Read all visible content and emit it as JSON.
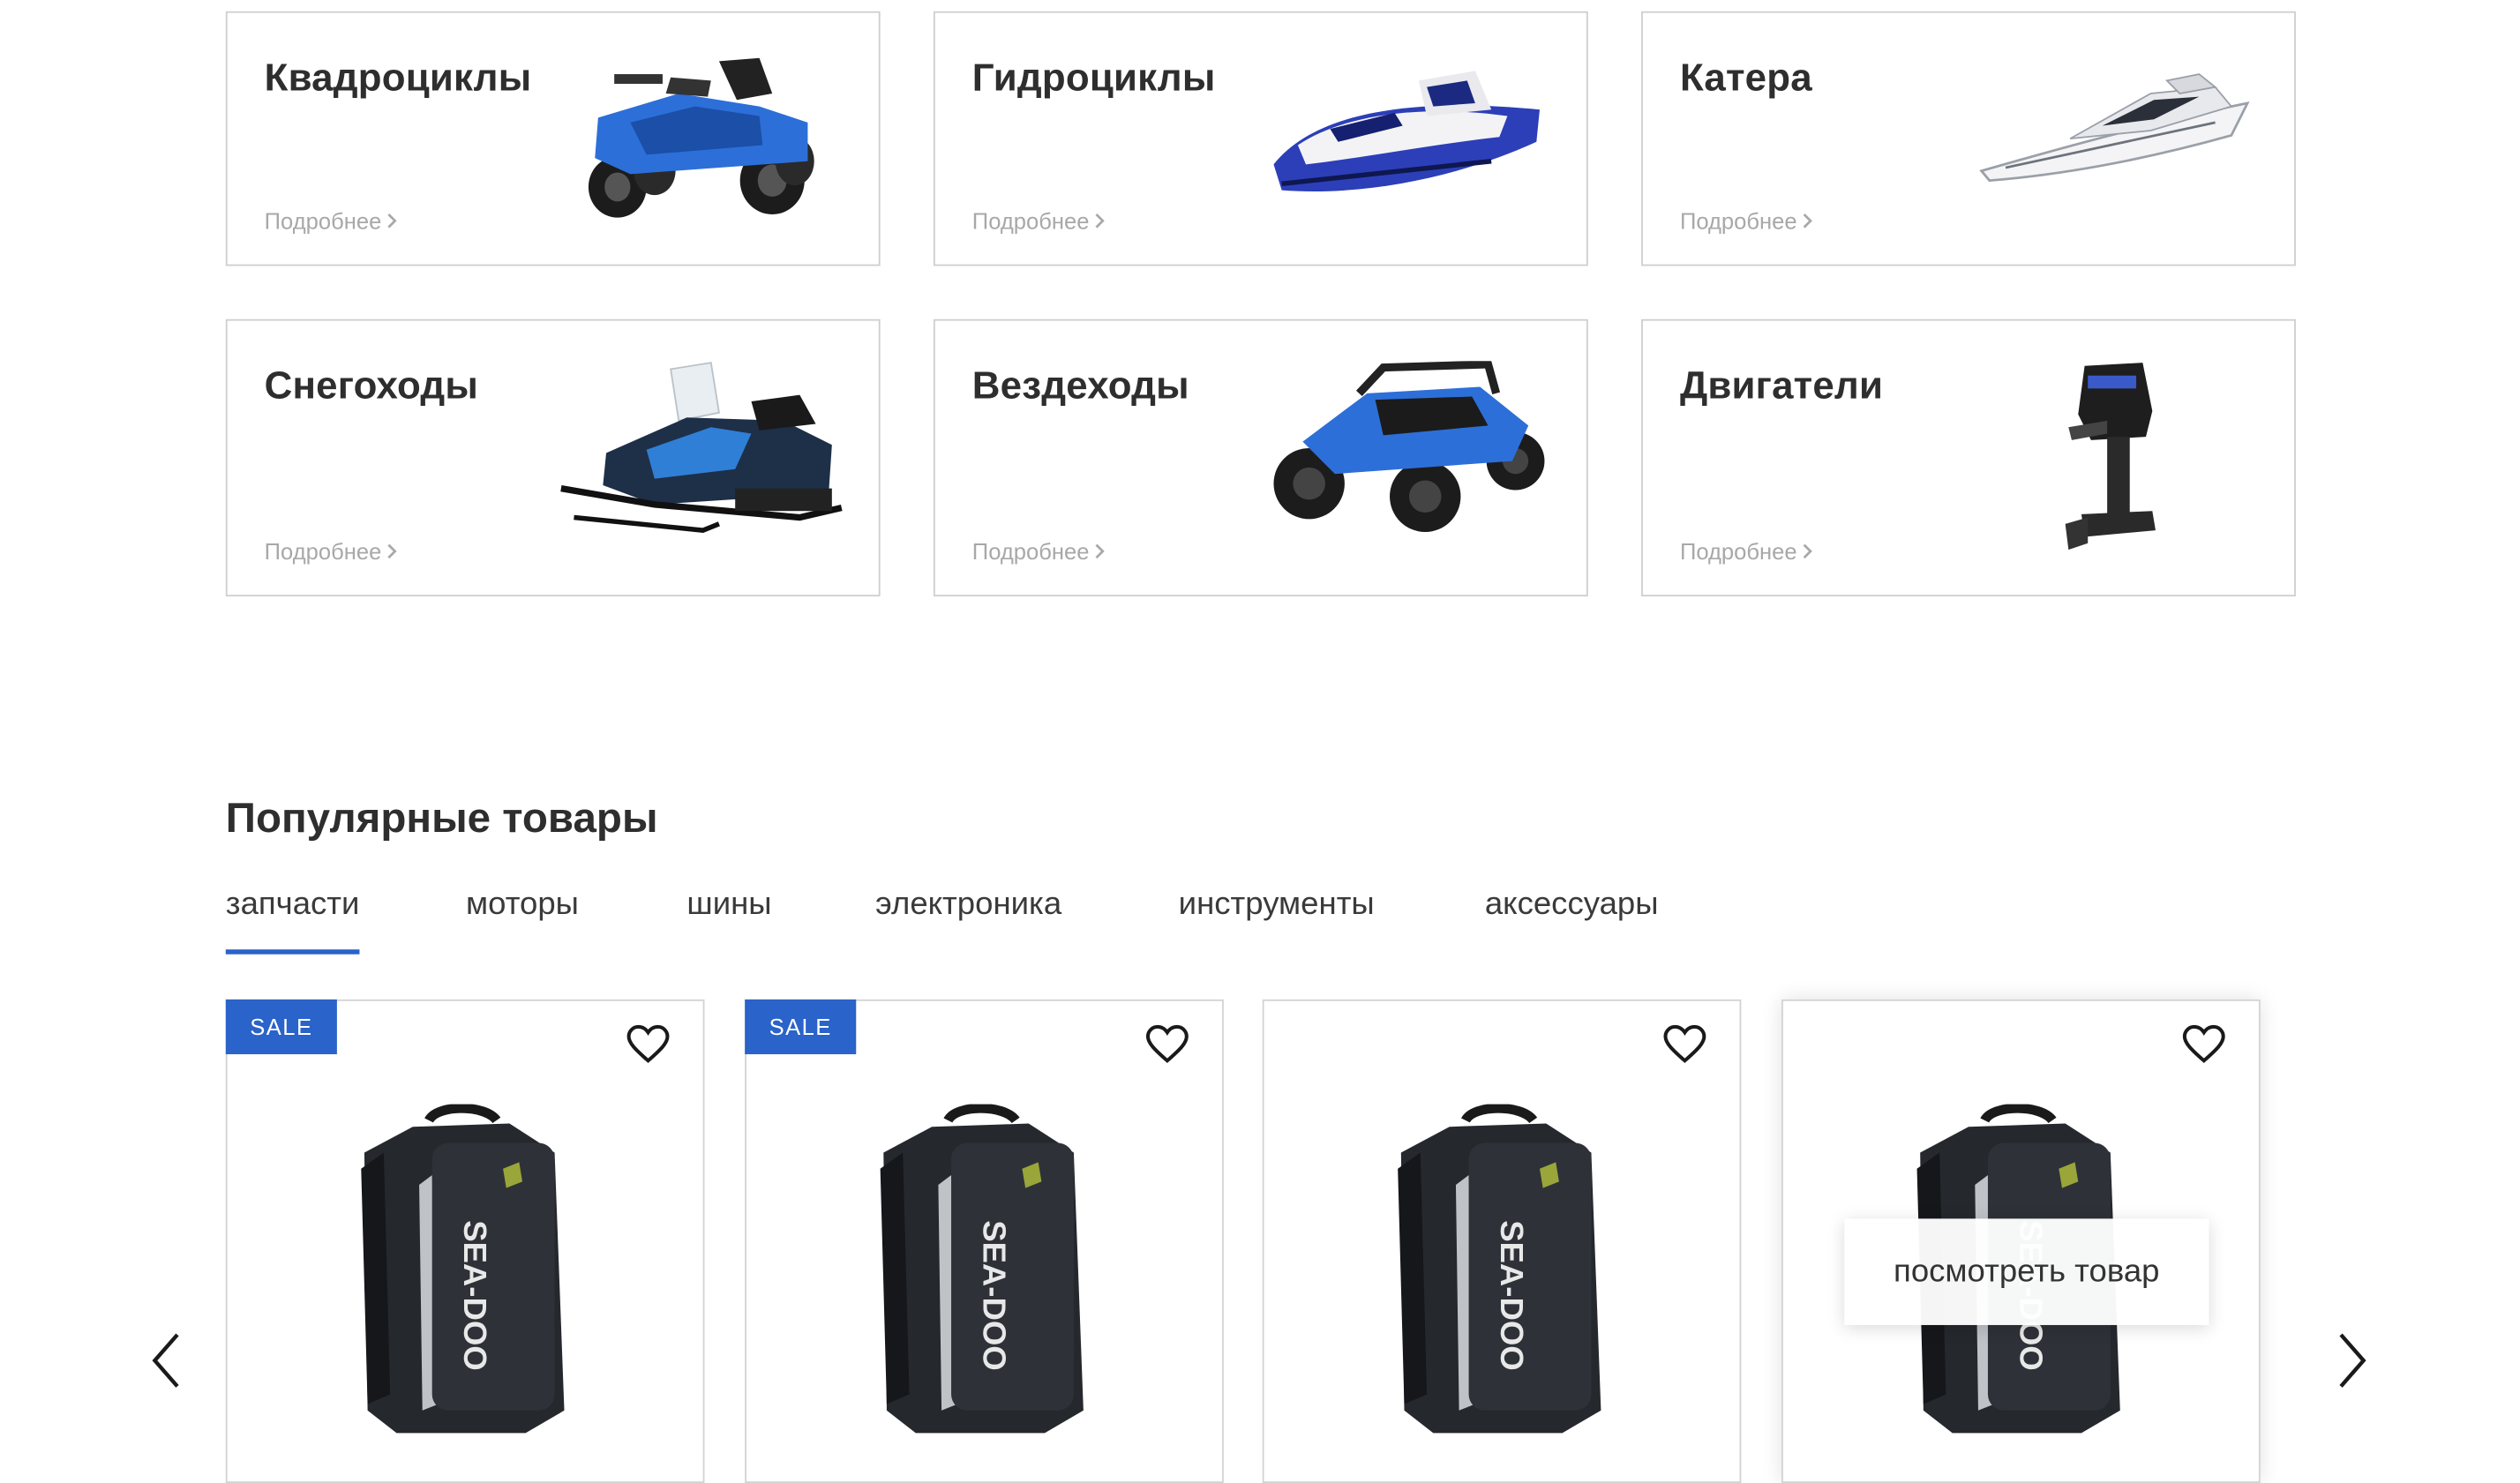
{
  "categories": [
    {
      "title": "Квадроциклы",
      "more": "Подробнее",
      "image": "atv-image"
    },
    {
      "title": "Гидроциклы",
      "more": "Подробнее",
      "image": "jetski-image"
    },
    {
      "title": "Катера",
      "more": "Подробнее",
      "image": "boat-image"
    },
    {
      "title": "Снегоходы",
      "more": "Подробнее",
      "image": "snowmobile-image"
    },
    {
      "title": "Вездеходы",
      "more": "Подробнее",
      "image": "buggy-image"
    },
    {
      "title": "Двигатели",
      "more": "Подробнее",
      "image": "outboard-motor-image"
    }
  ],
  "popular": {
    "title": "Популярные товары",
    "tabs": [
      {
        "label": "запчасти",
        "active": true
      },
      {
        "label": "моторы",
        "active": false
      },
      {
        "label": "шины",
        "active": false
      },
      {
        "label": "электроника",
        "active": false
      },
      {
        "label": "инструменты",
        "active": false
      },
      {
        "label": "аксессуары",
        "active": false
      }
    ],
    "products": [
      {
        "badge": "SALE",
        "brand_print": "SEA-DOO",
        "image": "backpack-image"
      },
      {
        "badge": "SALE",
        "brand_print": "SEA-DOO",
        "image": "backpack-image"
      },
      {
        "badge": "",
        "brand_print": "SEA-DOO",
        "image": "backpack-image"
      },
      {
        "badge": "",
        "brand_print": "SEA-DOO",
        "image": "backpack-image",
        "hover_button": "посмотреть товар"
      }
    ]
  },
  "colors": {
    "accent": "#2a63c9",
    "border": "#cfcfcf",
    "muted": "#a8a8a8"
  },
  "icons": {
    "heart": "heart-icon",
    "prev": "chevron-left-icon",
    "next": "chevron-right-icon",
    "more": "chevron-right-small-icon"
  }
}
